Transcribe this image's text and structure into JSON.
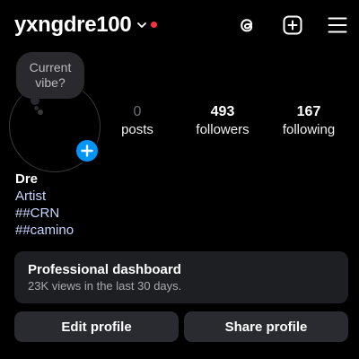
{
  "header": {
    "username": "yxngdre100",
    "chevron_icon": "chevron-down-icon",
    "notification_dot_color": "#ff3040",
    "icons": [
      "threads-icon",
      "create-plus-icon",
      "hamburger-menu-icon"
    ]
  },
  "profile": {
    "note_line1": "Current",
    "note_line2": "vibe?",
    "add_story_icon": "plus-icon",
    "add_story_color": "#0095f6"
  },
  "stats": {
    "posts": {
      "count": "0",
      "label": "posts"
    },
    "followers": {
      "count": "493",
      "label": "followers"
    },
    "following": {
      "count": "167",
      "label": "following"
    }
  },
  "bio": {
    "name": "Dre",
    "category": "Artist",
    "hashtag1": "##CRN",
    "hashtag2": "##camino"
  },
  "dashboard": {
    "title": "Professional dashboard",
    "subtitle": "23K views in the last 30 days."
  },
  "actions": {
    "edit_label": "Edit profile",
    "share_label": "Share profile"
  }
}
